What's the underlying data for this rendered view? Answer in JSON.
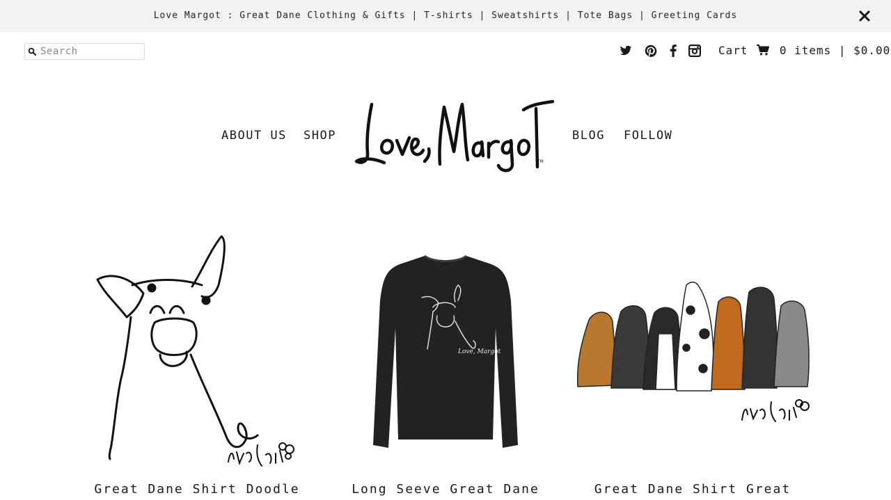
{
  "announcement": {
    "text": "Love Margot : Great Dane Clothing & Gifts | T-shirts | Sweatshirts | Tote Bags | Greeting Cards"
  },
  "search": {
    "placeholder": "Search",
    "value": ""
  },
  "social": [
    "twitter-icon",
    "pinterest-icon",
    "facebook-icon",
    "instagram-icon"
  ],
  "cart": {
    "label": "Cart",
    "summary": "0 items | $0.00"
  },
  "nav": {
    "about": "ABOUT US",
    "shop": "SHOP",
    "blog": "BLOG",
    "follow": "FOLLOW"
  },
  "products": [
    {
      "title": "Great Dane Shirt Doodle",
      "image": "great-dane-doodle-drawing"
    },
    {
      "title": "Long Seeve Great Dane",
      "image": "black-long-sleeve-shirt"
    },
    {
      "title": "Great Dane Shirt Great",
      "image": "seven-great-danes-illustration"
    }
  ],
  "colors": {
    "announcement_bg": "#f2f2f2",
    "text": "#1a1a1a",
    "shirt": "#222222"
  }
}
